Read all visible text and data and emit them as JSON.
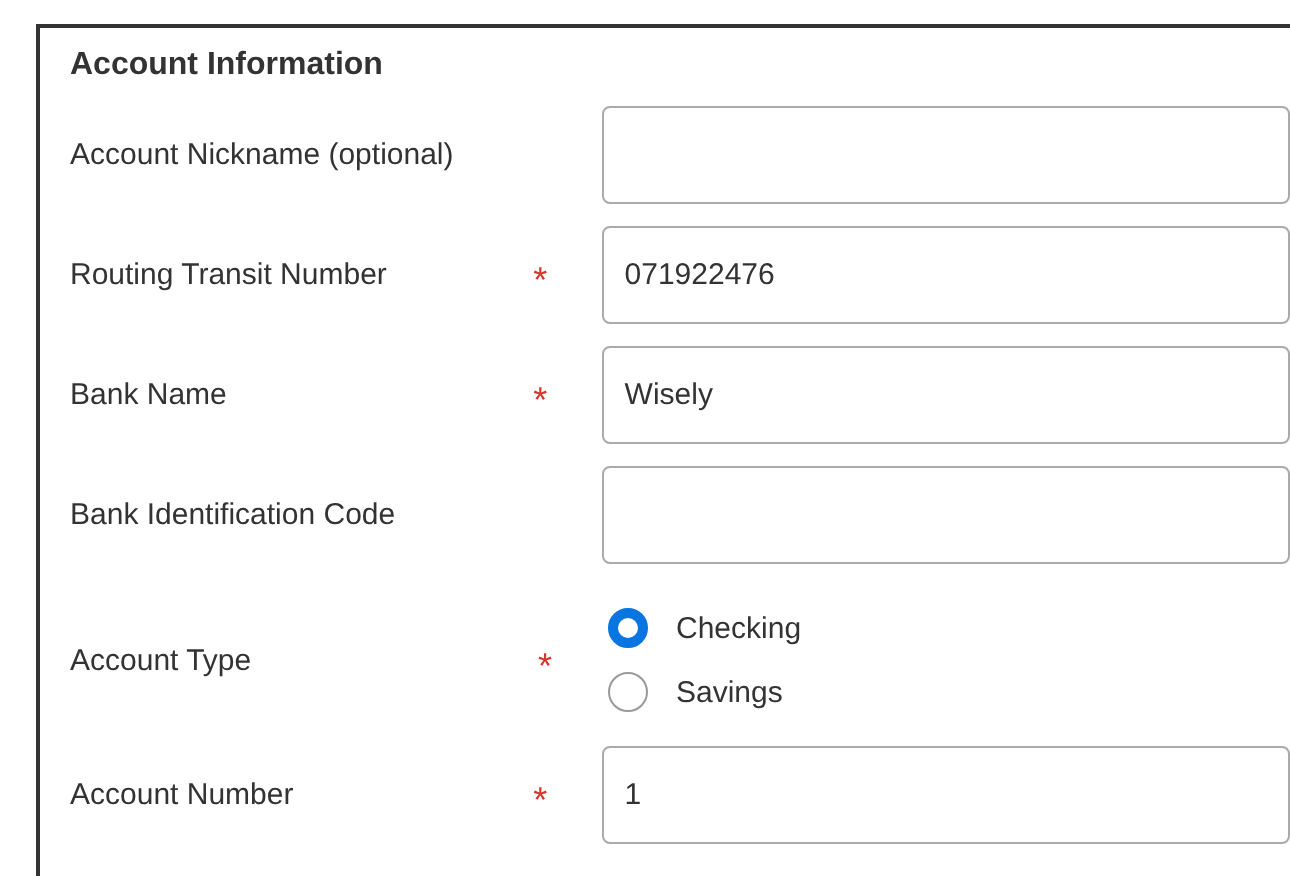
{
  "section": {
    "title": "Account Information"
  },
  "fields": [
    {
      "kind": "text",
      "label": "Account Nickname (optional)",
      "required": false
    },
    {
      "kind": "text",
      "label": "Routing Transit Number",
      "required": true,
      "value": "071922476"
    },
    {
      "kind": "text",
      "label": "Bank Name",
      "required": true,
      "value": "Wisely"
    },
    {
      "kind": "text",
      "label": "Bank Identification Code",
      "required": false
    },
    {
      "kind": "radio",
      "label": "Account Type",
      "required": true,
      "options": [
        {
          "label": "Checking",
          "selected": true
        },
        {
          "label": "Savings",
          "selected": false
        }
      ]
    },
    {
      "kind": "text",
      "label": "Account Number",
      "required": true,
      "value": "1"
    }
  ],
  "required_mark": "*"
}
